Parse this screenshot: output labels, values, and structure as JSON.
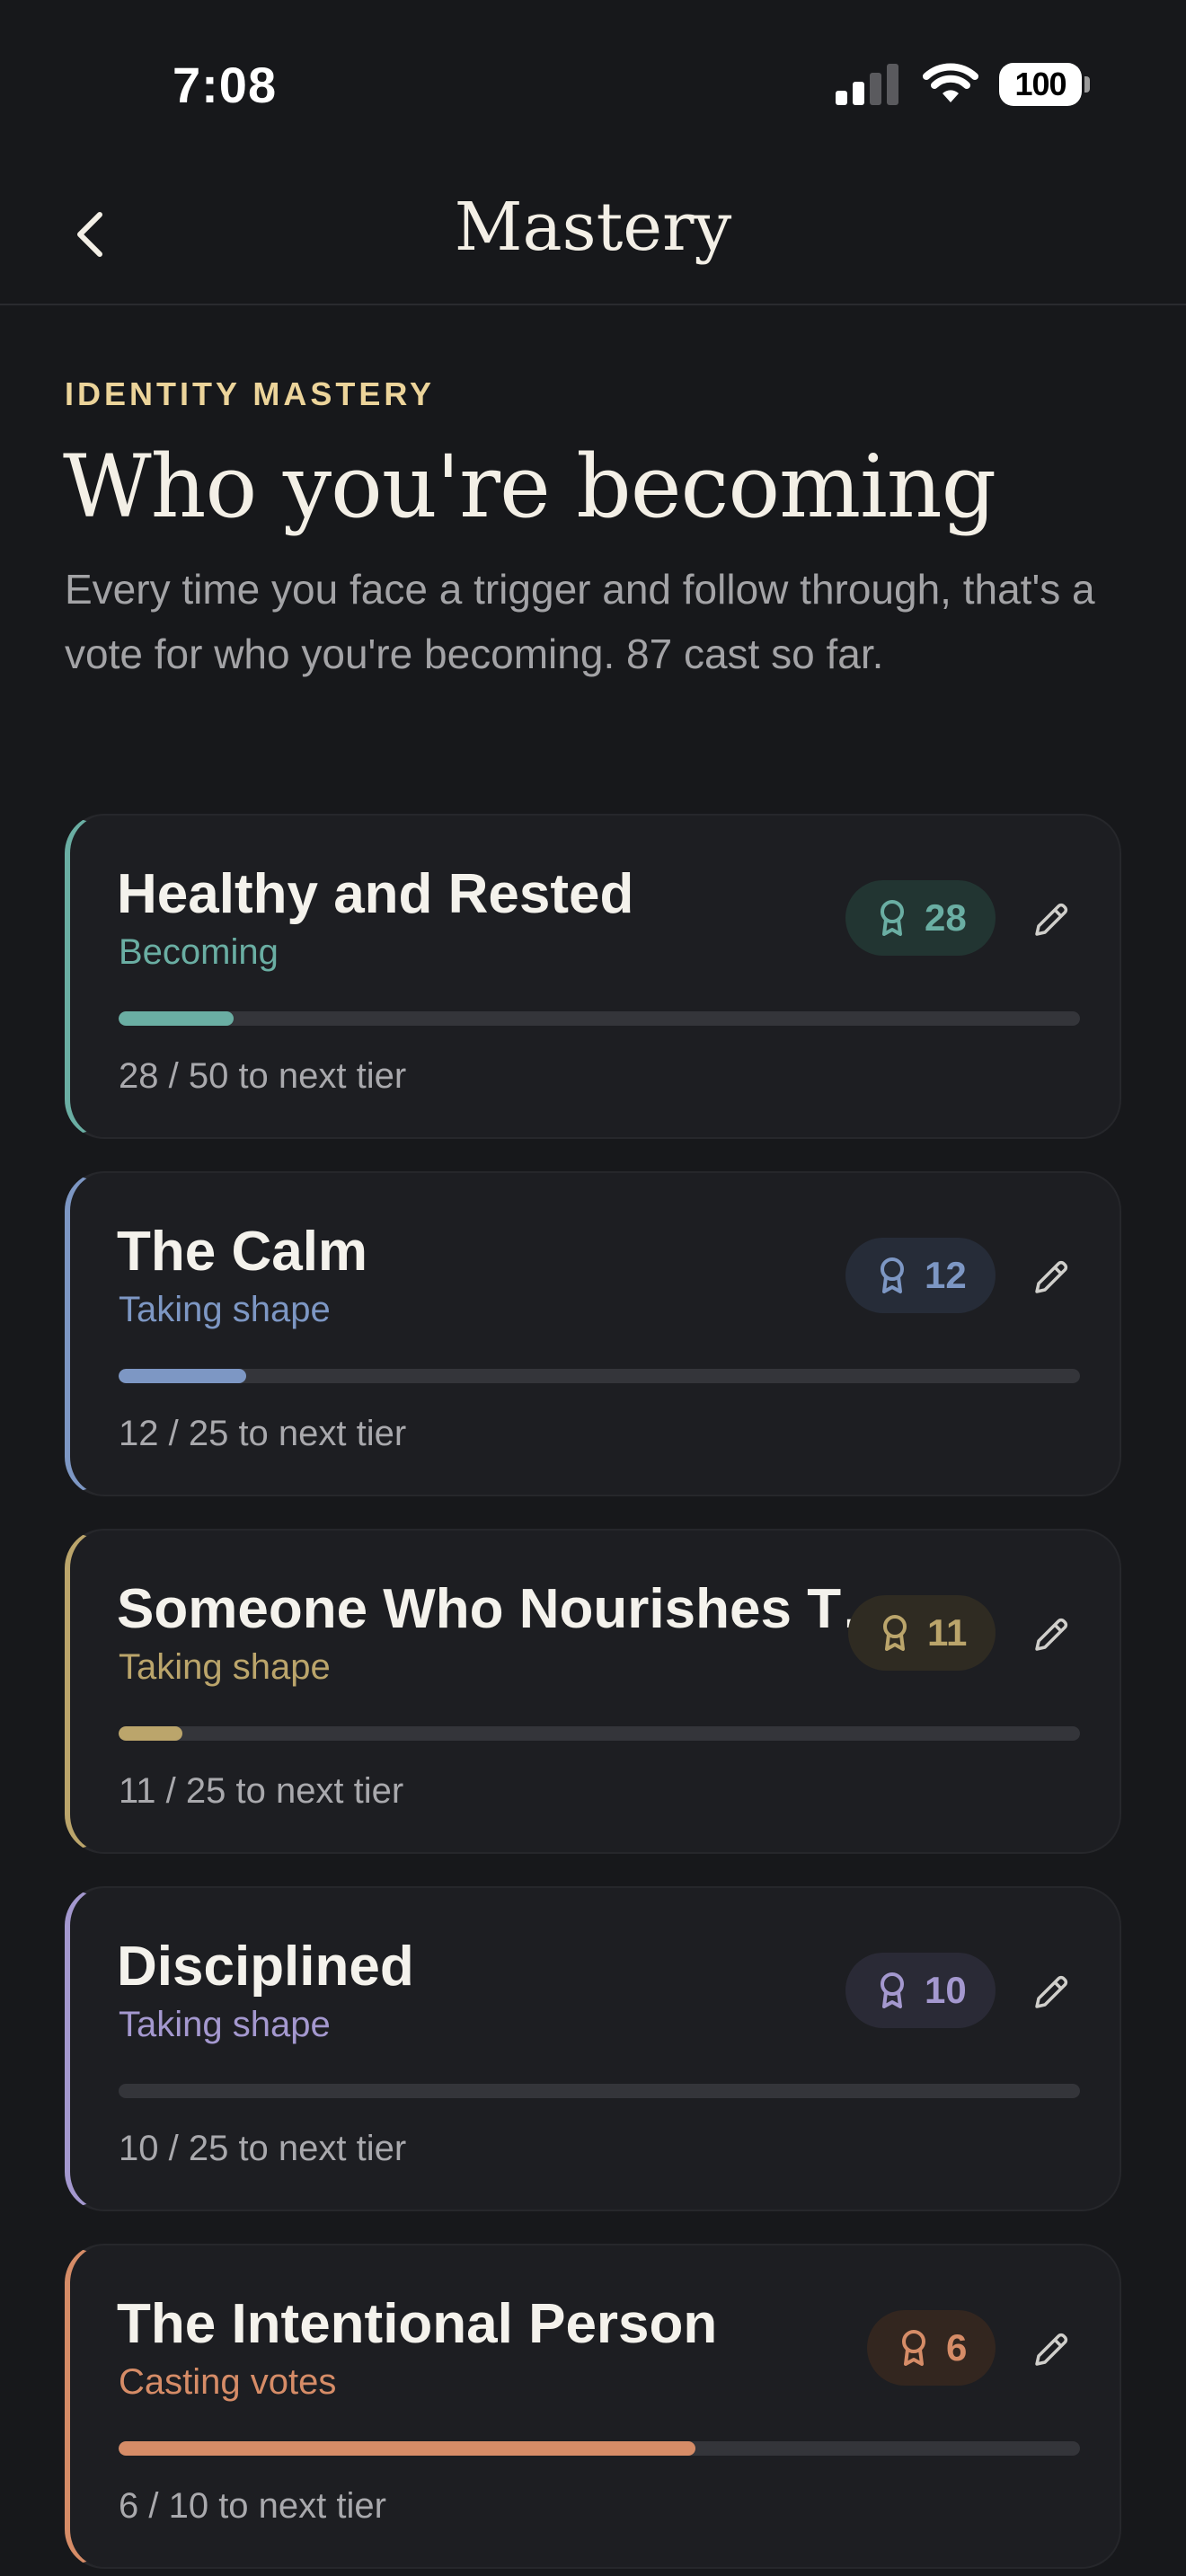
{
  "status_bar": {
    "time": "7:08",
    "battery": "100"
  },
  "nav": {
    "title": "Mastery",
    "back_icon": "chevron-left-icon"
  },
  "header": {
    "eyebrow": "IDENTITY MASTERY",
    "heading": "Who you're becoming",
    "description": "Every time you face a trigger and follow through, that's a vote for who you're becoming. 87 cast so far."
  },
  "identities": [
    {
      "title": "Healthy and Rested",
      "status": "Becoming",
      "votes": "28",
      "progress_text": "28 / 50 to next tier",
      "progress_fraction": 0.12,
      "accent": "#6aaea3",
      "badge_bg": "#223532",
      "badge_icon": "award-ribbon-icon",
      "edit_icon": "pencil-icon"
    },
    {
      "title": "The Calm",
      "status": "Taking shape",
      "votes": "12",
      "progress_text": "12 / 25 to next tier",
      "progress_fraction": 0.133,
      "accent": "#7d97c4",
      "badge_bg": "#262c38",
      "badge_icon": "award-ribbon-icon",
      "edit_icon": "pencil-icon"
    },
    {
      "title": "Someone Who Nourishes Their Body",
      "status": "Taking shape",
      "votes": "11",
      "progress_text": "11 / 25 to next tier",
      "progress_fraction": 0.066,
      "accent": "#bba56b",
      "badge_bg": "#2f2b22",
      "badge_icon": "award-ribbon-icon",
      "edit_icon": "pencil-icon"
    },
    {
      "title": "Disciplined",
      "status": "Taking shape",
      "votes": "10",
      "progress_text": "10 / 25 to next tier",
      "progress_fraction": 0.0,
      "accent": "#a498cf",
      "badge_bg": "#2a2a36",
      "badge_icon": "award-ribbon-icon",
      "edit_icon": "pencil-icon"
    },
    {
      "title": "The Intentional Person",
      "status": "Casting votes",
      "votes": "6",
      "progress_text": "6 / 10 to next tier",
      "progress_fraction": 0.6,
      "accent": "#d68c67",
      "badge_bg": "#33261f",
      "badge_icon": "award-ribbon-icon",
      "edit_icon": "pencil-icon"
    }
  ]
}
